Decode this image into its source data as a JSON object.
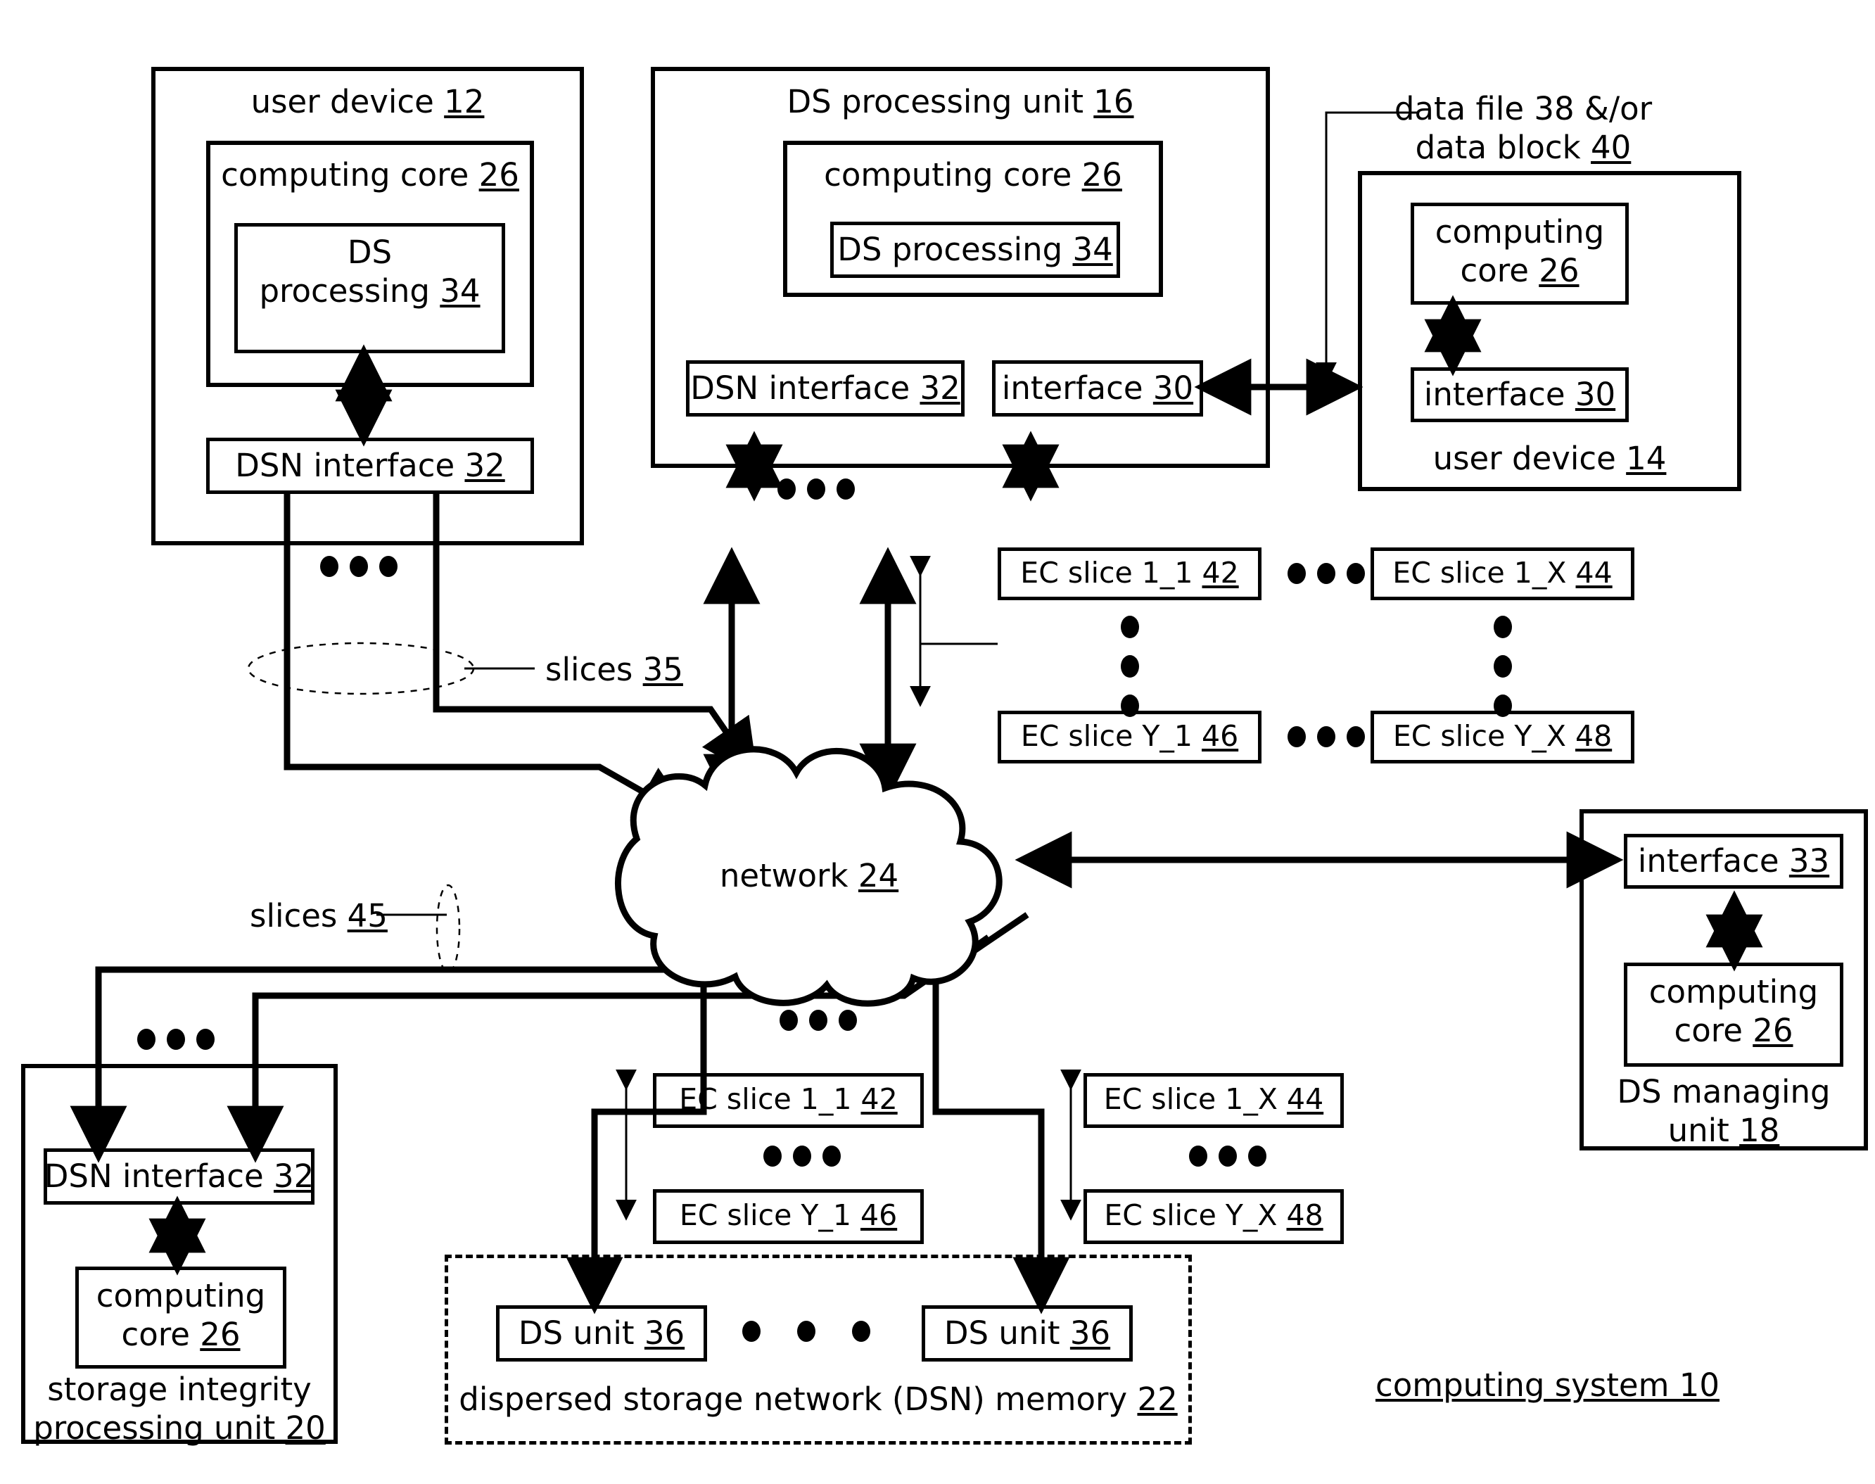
{
  "figure": {
    "system_label": "computing system 10",
    "network_label": "network 24"
  },
  "user_device_12": {
    "title": "user device 12",
    "computing_core": "computing core 26",
    "ds_processing": "DS\nprocessing 34",
    "ds_processing_line1": "DS",
    "ds_processing_line2": "processing 34",
    "dsn_interface": "DSN interface 32"
  },
  "ds_processing_unit_16": {
    "title": "DS processing unit 16",
    "computing_core": "computing core 26",
    "ds_processing": "DS processing 34",
    "dsn_interface": "DSN interface 32",
    "interface": "interface 30"
  },
  "user_device_14": {
    "title": "user device 14",
    "computing_core_line1": "computing",
    "computing_core_line2": "core 26",
    "interface": "interface 30"
  },
  "data_annotation": {
    "line1": "data file 38 &/or",
    "line2": "data block 40"
  },
  "slices_labels": {
    "slices_35": "slices 35",
    "slices_45": "slices 45"
  },
  "ec_slices_upper": {
    "top_left": "EC slice 1_1 42",
    "top_right": "EC slice 1_X 44",
    "bottom_left": "EC slice Y_1 46",
    "bottom_right": "EC slice Y_X 48"
  },
  "ec_slices_lower": {
    "left_top": "EC slice 1_1 42",
    "left_bottom": "EC slice Y_1 46",
    "right_top": "EC slice 1_X 44",
    "right_bottom": "EC slice Y_X 48"
  },
  "ds_managing_unit_18": {
    "interface": "interface 33",
    "computing_core_line1": "computing",
    "computing_core_line2": "core 26",
    "title_line1": "DS managing",
    "title_line2": "unit 18"
  },
  "storage_integrity_unit_20": {
    "dsn_interface": "DSN interface 32",
    "computing_core_line1": "computing",
    "computing_core_line2": "core 26",
    "title_line1": "storage integrity",
    "title_line2": "processing unit 20"
  },
  "dsn_memory_22": {
    "title": "dispersed storage network (DSN) memory 22",
    "ds_unit_left": "DS unit 36",
    "ds_unit_right": "DS unit 36"
  },
  "colors": {
    "ink": "#000000",
    "paper": "#ffffff"
  }
}
